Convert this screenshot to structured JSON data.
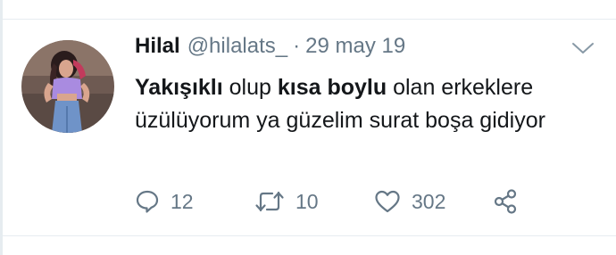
{
  "tweet": {
    "author_name": "Hilal",
    "author_handle": "@hilalats_",
    "separator": "·",
    "date": "29 may 19",
    "text_parts": [
      {
        "text": "Yakışıklı",
        "bold": true
      },
      {
        "text": " olup ",
        "bold": false
      },
      {
        "text": "kısa boylu",
        "bold": true
      },
      {
        "text": " olan erkeklere üzülüyorum ya güzelim surat boşa gidiyor",
        "bold": false
      }
    ]
  },
  "actions": {
    "reply_count": "12",
    "retweet_count": "10",
    "like_count": "302"
  },
  "icons": {
    "reply": "speech-bubble-icon",
    "retweet": "retweet-arrows-icon",
    "like": "heart-icon",
    "share": "share-nodes-icon",
    "more": "chevron-down-icon"
  },
  "colors": {
    "text": "#14171a",
    "secondary": "#657786",
    "divider": "#e6ecf0"
  }
}
